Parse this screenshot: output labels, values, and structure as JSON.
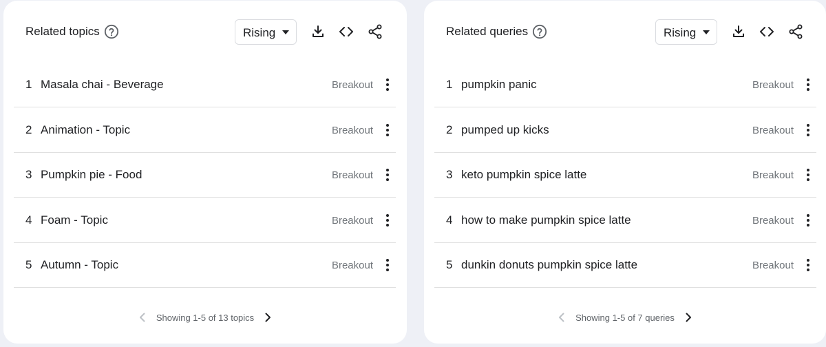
{
  "colors": {
    "background": "#eef0f6",
    "card": "#ffffff",
    "text": "#202124",
    "muted": "#70757a",
    "divider": "#e0e0e0",
    "disabled": "#bdc1c6"
  },
  "panels": [
    {
      "title": "Related topics",
      "help_icon": "help-circle-icon",
      "dropdown_value": "Rising",
      "tools": [
        "download-icon",
        "embed-code-icon",
        "share-icon"
      ],
      "rows": [
        {
          "rank": "1",
          "label": "Masala chai - Beverage",
          "value": "Breakout"
        },
        {
          "rank": "2",
          "label": "Animation - Topic",
          "value": "Breakout"
        },
        {
          "rank": "3",
          "label": "Pumpkin pie - Food",
          "value": "Breakout"
        },
        {
          "rank": "4",
          "label": "Foam - Topic",
          "value": "Breakout"
        },
        {
          "rank": "5",
          "label": "Autumn - Topic",
          "value": "Breakout"
        }
      ],
      "pagination_text": "Showing 1-5 of 13 topics"
    },
    {
      "title": "Related queries",
      "help_icon": "help-circle-icon",
      "dropdown_value": "Rising",
      "tools": [
        "download-icon",
        "embed-code-icon",
        "share-icon"
      ],
      "rows": [
        {
          "rank": "1",
          "label": "pumpkin panic",
          "value": "Breakout"
        },
        {
          "rank": "2",
          "label": "pumped up kicks",
          "value": "Breakout"
        },
        {
          "rank": "3",
          "label": "keto pumpkin spice latte",
          "value": "Breakout"
        },
        {
          "rank": "4",
          "label": "how to make pumpkin spice latte",
          "value": "Breakout"
        },
        {
          "rank": "5",
          "label": "dunkin donuts pumpkin spice latte",
          "value": "Breakout"
        }
      ],
      "pagination_text": "Showing 1-5 of 7 queries"
    }
  ]
}
